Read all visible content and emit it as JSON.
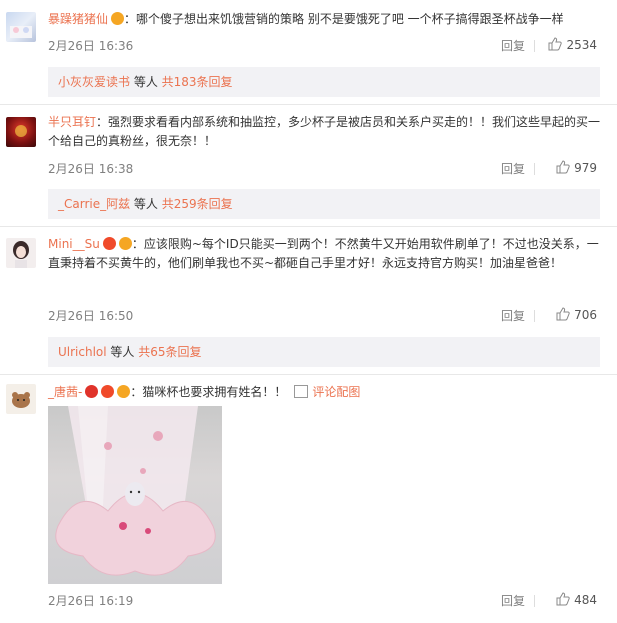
{
  "comments": [
    {
      "username": "暴躁猪猪仙",
      "text": "：哪个傻子想出来饥饿营销的策略 别不是要饿死了吧 一个杯子搞得跟圣杯战争一样",
      "date": "2月26日 16:36",
      "reply_label": "回复",
      "likes": "2534",
      "replies": {
        "name": "小灰灰爱读书",
        "middle": " 等人 ",
        "count": "共183条回复"
      }
    },
    {
      "username": "半只耳钉",
      "text": "：强烈要求看看内部系统和抽监控，多少杯子是被店员和关系户买走的！！我们这些早起的买一个给自己的真粉丝，很无奈！！",
      "date": "2月26日 16:38",
      "reply_label": "回复",
      "likes": "979",
      "replies": {
        "name": "_Carrie_阿兹",
        "middle": " 等人 ",
        "count": "共259条回复"
      }
    },
    {
      "username": "Mini__Su",
      "text": "：应该限购~每个ID只能买一到两个！不然黄牛又开始用软件刷单了！不过也没关系，一直秉持着不买黄牛的，他们刷单我也不买~都砸自己手里才好！永远支持官方购买！加油星爸爸！",
      "date": "2月26日 16:50",
      "reply_label": "回复",
      "likes": "706",
      "replies": {
        "name": "Ulrichlol",
        "middle": " 等人 ",
        "count": "共65条回复"
      }
    },
    {
      "username": "_唐茜-",
      "text": "：猫咪杯也要求拥有姓名！！",
      "pic_label": "评论配图",
      "date": "2月26日 16:19",
      "reply_label": "回复",
      "likes": "484"
    }
  ],
  "colors": {
    "username": "#eb7350",
    "reply_bg": "#f2f2f5",
    "meta": "#808080"
  },
  "icons": {
    "like": "thumbs-up-icon",
    "picture": "picture-icon",
    "badge": "vip-badge-icon"
  }
}
